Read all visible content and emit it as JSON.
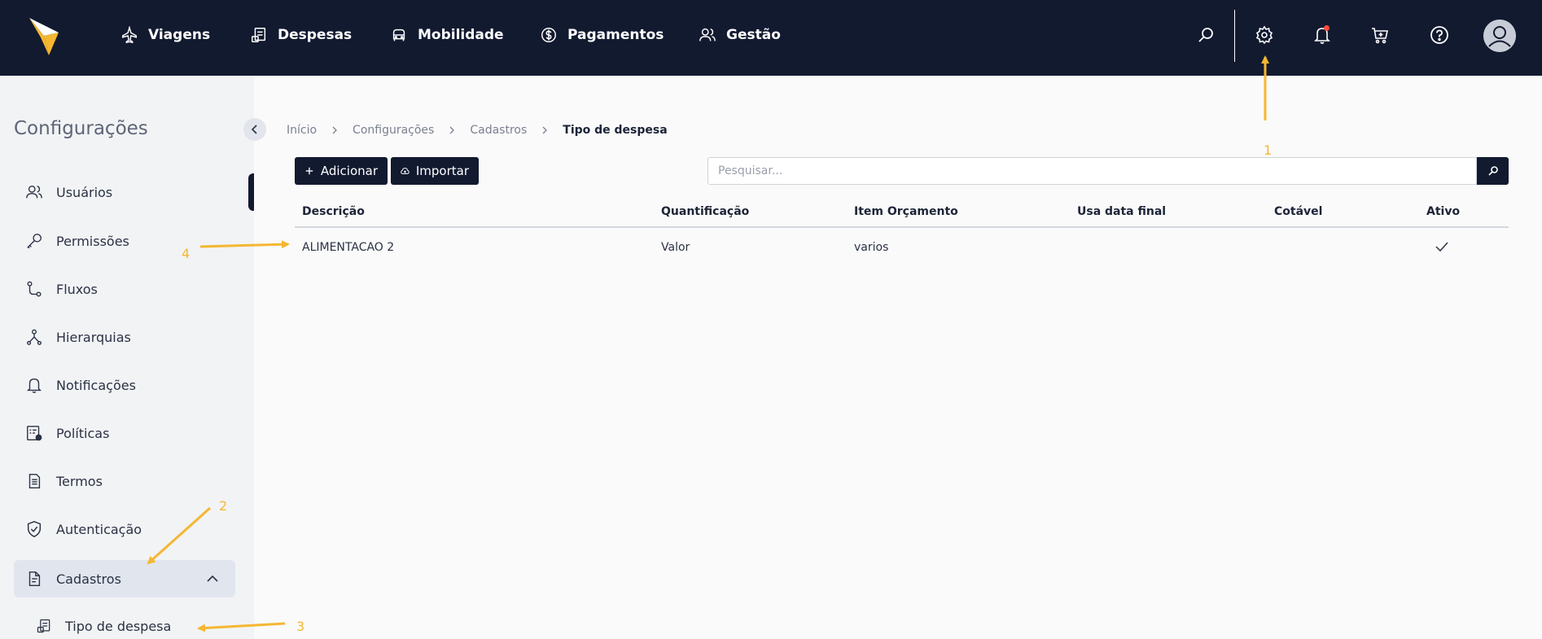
{
  "topnav": {
    "items": [
      {
        "label": "Viagens",
        "icon": "airplane-icon"
      },
      {
        "label": "Despesas",
        "icon": "expense-icon"
      },
      {
        "label": "Mobilidade",
        "icon": "car-icon"
      },
      {
        "label": "Pagamentos",
        "icon": "dollar-circle-icon"
      },
      {
        "label": "Gestão",
        "icon": "users-icon"
      }
    ],
    "icons": [
      "search-icon",
      "gear-icon",
      "bell-icon",
      "cart-icon",
      "help-icon",
      "avatar"
    ]
  },
  "sidebar": {
    "title": "Configurações",
    "items": [
      {
        "label": "Usuários",
        "icon": "users-icon"
      },
      {
        "label": "Permissões",
        "icon": "key-icon"
      },
      {
        "label": "Fluxos",
        "icon": "flow-icon"
      },
      {
        "label": "Hierarquias",
        "icon": "hierarchy-icon"
      },
      {
        "label": "Notificações",
        "icon": "bell-icon"
      },
      {
        "label": "Políticas",
        "icon": "policy-icon"
      },
      {
        "label": "Termos",
        "icon": "document-icon"
      },
      {
        "label": "Autenticação",
        "icon": "shield-check-icon"
      },
      {
        "label": "Cadastros",
        "icon": "file-icon",
        "expanded": true
      }
    ],
    "subitems": [
      {
        "label": "Tipo de despesa",
        "icon": "expense-icon"
      }
    ]
  },
  "breadcrumb": [
    "Início",
    "Configurações",
    "Cadastros",
    "Tipo de despesa"
  ],
  "toolbar": {
    "add_label": "Adicionar",
    "import_label": "Importar",
    "search_placeholder": "Pesquisar..."
  },
  "table": {
    "headers": [
      "Descrição",
      "Quantificação",
      "Item Orçamento",
      "Usa data final",
      "Cotável",
      "Ativo"
    ],
    "rows": [
      {
        "descricao": "ALIMENTACAO 2",
        "quantificacao": "Valor",
        "item_orcamento": "varios",
        "usa_data_final": "",
        "cotavel": "",
        "ativo": true
      }
    ]
  },
  "annotations": [
    "1",
    "2",
    "3",
    "4"
  ],
  "colors": {
    "navy": "#121a30",
    "accent_yellow": "#f5b731",
    "notification_dot": "#ff4d3d"
  }
}
